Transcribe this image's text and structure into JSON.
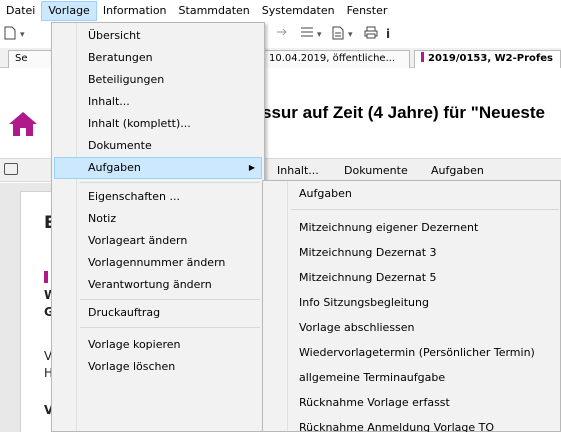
{
  "menubar": [
    "Datei",
    "Vorlage",
    "Information",
    "Stammdaten",
    "Systemdaten",
    "Fenster"
  ],
  "toolbar": {
    "dropdown_arrow": "▾",
    "info_label": "i"
  },
  "tabs": [
    {
      "label": "Se"
    },
    {
      "label": "10.04.2019, öffentliche..."
    },
    {
      "label": "2019/0153, W2-Profes"
    }
  ],
  "page_title": "ssur auf Zeit (4 Jahre) für \"Neueste",
  "subbar": {
    "inhalt": "Inhalt...",
    "dokumente": "Dokumente",
    "aufgaben": "Aufgaben"
  },
  "content_fragments": {
    "e": "E",
    "w": "W",
    "g": "G",
    "v1": "V",
    "h": "H",
    "v2": "V"
  },
  "menu": {
    "items": [
      "Übersicht",
      "Beratungen",
      "Beteiligungen",
      "Inhalt...",
      "Inhalt (komplett)...",
      "Dokumente",
      "Aufgaben",
      "Eigenschaften ...",
      "Notiz",
      "Vorlageart ändern",
      "Vorlagennummer ändern",
      "Verantwortung ändern",
      "Druckauftrag",
      "Vorlage kopieren",
      "Vorlage löschen"
    ]
  },
  "submenu": {
    "items": [
      "Aufgaben",
      "Mitzeichnung eigener Dezernent",
      "Mitzeichnung Dezernat 3",
      "Mitzeichnung Dezernat 5",
      "Info Sitzungsbegleitung",
      "Vorlage abschliessen",
      "Wiedervorlagetermin (Persönlicher Termin)",
      "allgemeine Terminaufgabe",
      "Rücknahme Vorlage erfasst",
      "Rücknahme Anmeldung Vorlage TO"
    ]
  },
  "colors": {
    "accent": "#b0198a",
    "highlight": "#cce8ff",
    "home": "#b0198a"
  }
}
